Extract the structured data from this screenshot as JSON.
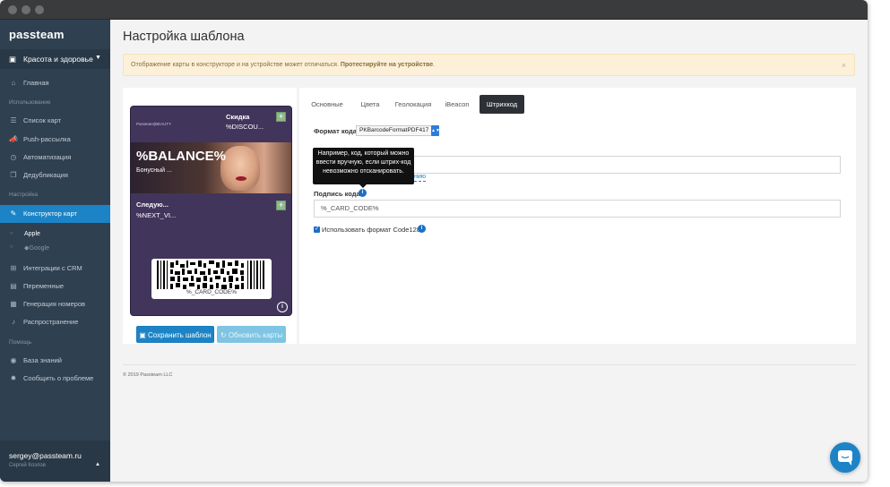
{
  "sidebar": {
    "logo": "passteam",
    "category": "Красота и здоровье",
    "items": [
      {
        "label": "Главная",
        "icon": "home-icon"
      },
      {
        "label": "Список карт",
        "icon": "list-icon"
      },
      {
        "label": "Push-рассылка",
        "icon": "bullhorn-icon"
      },
      {
        "label": "Автоматизация",
        "icon": "clock-icon"
      },
      {
        "label": "Дедубликация",
        "icon": "copy-icon"
      },
      {
        "label": "Конструктор карт",
        "icon": "brush-icon"
      },
      {
        "label": "Интеграции с CRM",
        "icon": "sitemap-icon"
      },
      {
        "label": "Переменные",
        "icon": "list-alt-icon"
      },
      {
        "label": "Генерация номеров",
        "icon": "th-icon"
      },
      {
        "label": "Распространение",
        "icon": "bell-icon"
      },
      {
        "label": "База знаний",
        "icon": "globe-icon"
      },
      {
        "label": "Сообщить о проблеме",
        "icon": "cog-icon"
      }
    ],
    "sections": {
      "usage": "Использование",
      "settings": "Настройка",
      "help": "Помощь"
    },
    "sub_items": [
      {
        "label": "Apple"
      },
      {
        "label": "Google"
      }
    ],
    "user": {
      "email": "sergey@passteam.ru",
      "name": "Сергей Козлов"
    }
  },
  "page": {
    "title": "Настройка шаблона",
    "alert": {
      "text": "Отображение карты в конструкторе и на устройстве может отличаться. ",
      "link": "Протестируйте на устройстве",
      "end": "."
    },
    "footer": "© 2019 Passteam LLC"
  },
  "card": {
    "brand": "Passteam|BEAUTY",
    "header_label": "Скидка",
    "header_value": "%DISCOU...",
    "primary_value": "%BALANCE%",
    "primary_label": "Бонусный ...",
    "secondary_label": "Следую...",
    "secondary_value": "%NEXT_VI...",
    "barcode_text": "%_CARD_CODE%"
  },
  "buttons": {
    "save": "Сохранить шаблон",
    "refresh": "Обновить карты"
  },
  "tabs": [
    "Основные",
    "Цвета",
    "Геолокация",
    "iBeacon",
    "Штрихкод"
  ],
  "barcode_settings": {
    "format_label": "Формат кода:",
    "format_value": "PKBarcodeFormatPDF417",
    "tooltip": "Например, код, который можно ввести вручную, если штрих-код невозможно отсканировать.",
    "link_partial": "нию",
    "caption_label": "Подпись кода:",
    "caption_value": "%_CARD_CODE%",
    "code128_label": "Использовать формат Code128"
  },
  "colors": {
    "sidebar": "#2f4050",
    "accent": "#1c84c6",
    "card_bg": "#42355c",
    "alert_bg": "#fcf0d9"
  }
}
